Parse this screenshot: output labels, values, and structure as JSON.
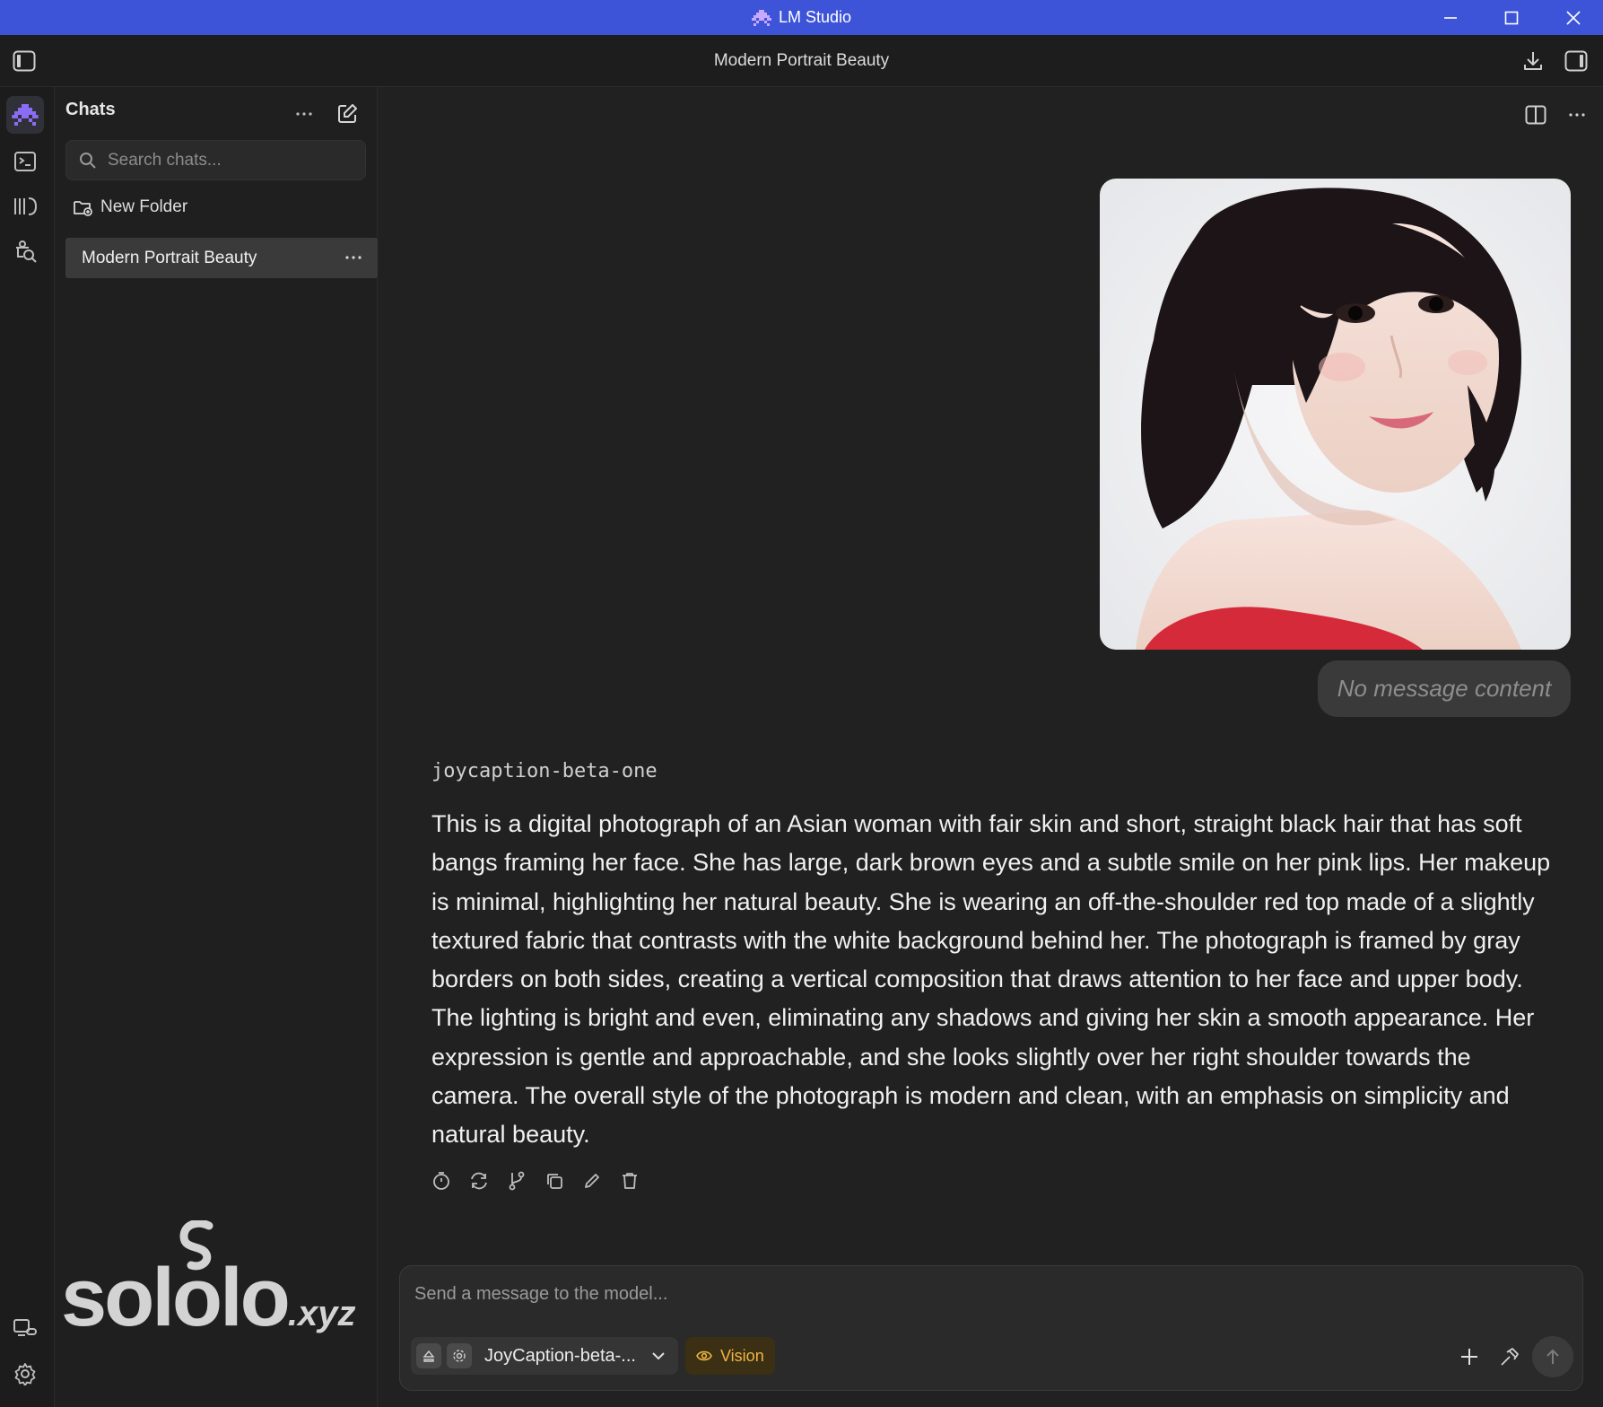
{
  "app": {
    "title": "LM Studio",
    "accent": "#3d54d9"
  },
  "window_controls": [
    "minimize-icon",
    "maximize-icon",
    "close-icon"
  ],
  "header": {
    "chat_title": "Modern Portrait Beauty"
  },
  "rail": {
    "items": [
      "chat-icon",
      "developer-icon",
      "models-icon",
      "discover-icon"
    ],
    "bottom": [
      "remote-link-icon",
      "settings-icon"
    ]
  },
  "sidebar": {
    "heading": "Chats",
    "search_placeholder": "Search chats...",
    "new_folder_label": "New Folder",
    "chats": [
      {
        "label": "Modern Portrait Beauty",
        "active": true
      }
    ]
  },
  "watermark": {
    "text": "sololo",
    "suffix": ".xyz"
  },
  "conversation": {
    "user_message_placeholder": "No message content",
    "assistant_model": "joycaption-beta-one",
    "assistant_text": "This is a digital photograph of an Asian woman with fair skin and short, straight black hair that has soft bangs framing her face. She has large, dark brown eyes and a subtle smile on her pink lips. Her makeup is minimal, highlighting her natural beauty. She is wearing an off-the-shoulder red top made of a slightly textured fabric that contrasts with the white background behind her. The photograph is framed by gray borders on both sides, creating a vertical composition that draws attention to her face and upper body. The lighting is bright and even, eliminating any shadows and giving her skin a smooth appearance. Her expression is gentle and approachable, and she looks slightly over her right shoulder towards the camera. The overall style of the photograph is modern and clean, with an emphasis on simplicity and natural beauty.",
    "actions": [
      "timer-icon",
      "regenerate-icon",
      "branch-icon",
      "copy-icon",
      "edit-icon",
      "delete-icon"
    ]
  },
  "composer": {
    "placeholder": "Send a message to the model...",
    "model_label": "JoyCaption-beta-...",
    "vision_label": "Vision",
    "vision_color": "#f0b542"
  }
}
